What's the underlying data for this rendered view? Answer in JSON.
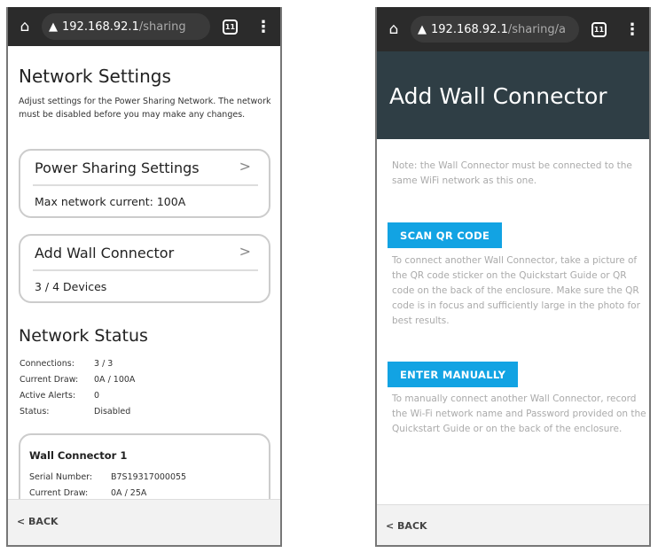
{
  "left": {
    "browser": {
      "host": "192.168.92.1",
      "path": "/sharing",
      "tab_count": "11"
    },
    "title": "Network Settings",
    "description": "Adjust settings for the Power Sharing Network. The network must be disabled before you may make any changes.",
    "cards": [
      {
        "title": "Power Sharing Settings",
        "subtitle": "Max network current: 100A"
      },
      {
        "title": "Add Wall Connector",
        "subtitle": "3 / 4 Devices"
      }
    ],
    "status_title": "Network Status",
    "status_rows": [
      {
        "label": "Connections:",
        "value": "3 / 3"
      },
      {
        "label": "Current Draw:",
        "value": "0A / 100A"
      },
      {
        "label": "Active Alerts:",
        "value": "0"
      },
      {
        "label": "Status:",
        "value": "Disabled"
      }
    ],
    "connector": {
      "title": "Wall Connector 1",
      "rows": [
        {
          "label": "Serial Number:",
          "value": "B7S19317000055"
        },
        {
          "label": "Current Draw:",
          "value": "0A / 25A"
        }
      ]
    },
    "back_label": "< BACK"
  },
  "right": {
    "browser": {
      "host": "192.168.92.1",
      "path": "/sharing/a",
      "tab_count": "11"
    },
    "title": "Add Wall Connector",
    "note": "Note: the Wall Connector must be connected to the same WiFi network as this one.",
    "scan_label": "SCAN QR CODE",
    "scan_text": "To connect another Wall Connector, take a picture of the QR code sticker on the Quickstart Guide or QR code on the back of the enclosure. Make sure the QR code is in focus and sufficiently large in the photo for best results.",
    "manual_label": "ENTER MANUALLY",
    "manual_text": "To manually connect another Wall Connector, record the Wi-Fi network name and Password provided on the Quickstart Guide or on the back of the enclosure.",
    "back_label": "< BACK"
  },
  "colors": {
    "header": "#2f3e45",
    "button": "#12a3e3",
    "browser_bar": "#2b2b2b"
  }
}
